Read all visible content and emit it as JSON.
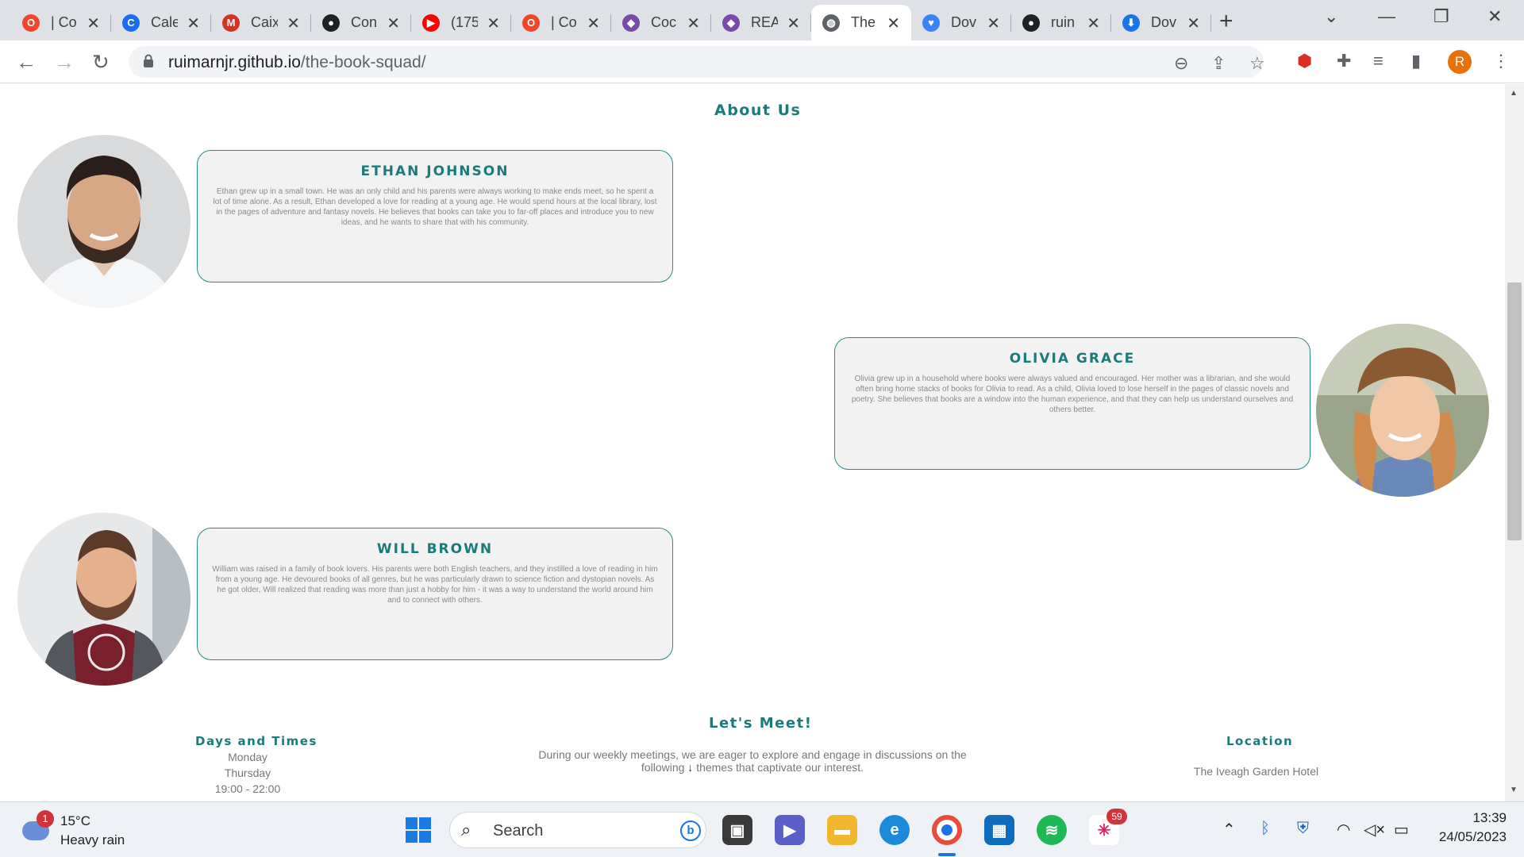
{
  "browser": {
    "tabs": [
      {
        "label": "| Co",
        "icon": "opera-icon",
        "color": "#f0462c",
        "glyph": "O"
      },
      {
        "label": "Cale",
        "icon": "calendly-icon",
        "color": "#1a6cf0",
        "glyph": "C"
      },
      {
        "label": "Caix",
        "icon": "gmail-icon",
        "color": "#d93025",
        "glyph": "M"
      },
      {
        "label": "Con",
        "icon": "github-icon",
        "color": "#202124",
        "glyph": "●"
      },
      {
        "label": "(175",
        "icon": "youtube-icon",
        "color": "#ff0000",
        "glyph": "▶"
      },
      {
        "label": "| Co",
        "icon": "opera-icon",
        "color": "#f0462c",
        "glyph": "O"
      },
      {
        "label": "Coc",
        "icon": "cube-icon",
        "color": "#7a4aa8",
        "glyph": "◆"
      },
      {
        "label": "REA",
        "icon": "cube-icon",
        "color": "#7a4aa8",
        "glyph": "◆"
      },
      {
        "label": "The",
        "icon": "globe-icon",
        "color": "#5f6368",
        "glyph": "◍",
        "active": true
      },
      {
        "label": "Dov",
        "icon": "heart-icon",
        "color": "#3b82f6",
        "glyph": "♥"
      },
      {
        "label": "ruin",
        "icon": "github-icon",
        "color": "#202124",
        "glyph": "●"
      },
      {
        "label": "Dov",
        "icon": "download-icon",
        "color": "#1a73e8",
        "glyph": "⬇"
      }
    ],
    "url_host": "ruimarnjr.github.io",
    "url_path": "/the-book-squad/"
  },
  "page": {
    "about_title": "About Us",
    "members": [
      {
        "name": "ETHAN JOHNSON",
        "bio": "Ethan grew up in a small town. He was an only child and his parents were always working to make ends meet, so he spent a lot of time alone. As a result, Ethan developed a love for reading at a young age. He would spend hours at the local library, lost in the pages of adventure and fantasy novels. He believes that books can take you to far-off places and introduce you to new ideas, and he wants to share that with his community."
      },
      {
        "name": "OLIVIA GRACE",
        "bio": "Olivia grew up in a household where books were always valued and encouraged. Her mother was a librarian, and she would often bring home stacks of books for Olivia to read. As a child, Olivia loved to lose herself in the pages of classic novels and poetry. She believes that books are a window into the human experience, and that they can help us understand ourselves and others better."
      },
      {
        "name": "WILL BROWN",
        "bio": "William was raised in a family of book lovers. His parents were both English teachers, and they instilled a love of reading in him from a young age. He devoured books of all genres, but he was particularly drawn to science fiction and dystopian novels. As he got older, Will realized that reading was more than just a hobby for him - it was a way to understand the world around him and to connect with others."
      }
    ],
    "meet_title": "Let's Meet!",
    "days_title": "Days and Times",
    "days": [
      "Monday",
      "Thursday",
      "19:00 - 22:00"
    ],
    "meet_intro_1": "During our weekly meetings, we are eager to explore and engage in discussions on the",
    "meet_intro_2a": "following",
    "meet_intro_2b": "themes that captivate our interest.",
    "location_title": "Location",
    "location": "The Iveagh Garden Hotel"
  },
  "taskbar": {
    "weather_temp": "15°C",
    "weather_desc": "Heavy rain",
    "weather_badge": "1",
    "search_placeholder": "Search",
    "slack_badge": "59",
    "time": "13:39",
    "date": "24/05/2023"
  },
  "profile_initial": "R"
}
